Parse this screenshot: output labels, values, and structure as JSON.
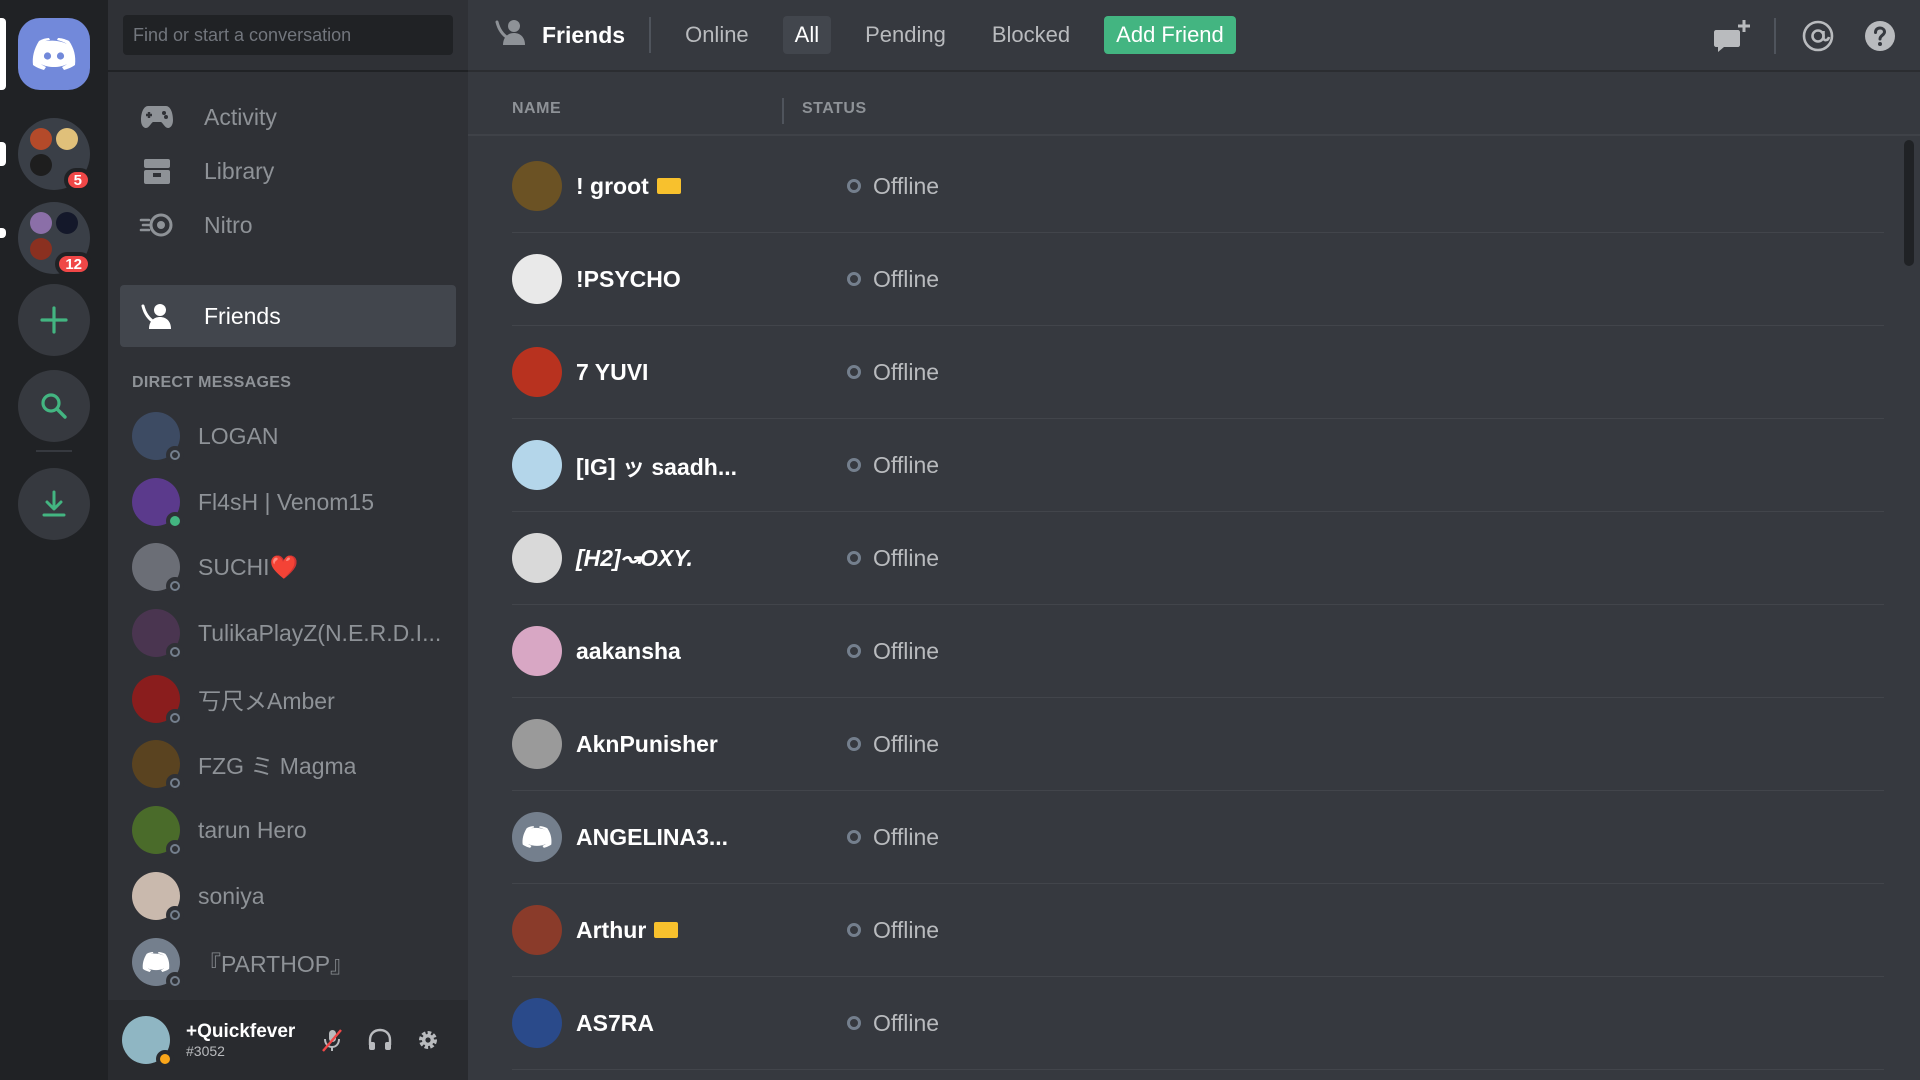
{
  "sidebar": {
    "search_placeholder": "Find or start a conversation",
    "nav": [
      {
        "label": "Activity",
        "icon": "controller-icon"
      },
      {
        "label": "Library",
        "icon": "library-icon"
      },
      {
        "label": "Nitro",
        "icon": "nitro-icon"
      },
      {
        "label": "Friends",
        "icon": "friends-icon"
      }
    ],
    "dm_header": "DIRECT MESSAGES",
    "dms": [
      {
        "name": "LOGAN",
        "status": "offline",
        "color": "#3d4b63"
      },
      {
        "name": "Fl4sH | Venom15",
        "status": "online",
        "color": "#5b3a8c"
      },
      {
        "name": "SUCHI❤️",
        "status": "offline",
        "color": "#6b6e76"
      },
      {
        "name": "TulikaPlayZ(N.E.R.D.I...",
        "status": "offline",
        "color": "#4a3550"
      },
      {
        "name": "丂尺メAmber",
        "status": "offline",
        "color": "#8a1d1d"
      },
      {
        "name": "FZG ミ Magma",
        "status": "offline",
        "color": "#5a4320"
      },
      {
        "name": "tarun Hero",
        "status": "offline",
        "color": "#4a6b2a"
      },
      {
        "name": "soniya",
        "status": "offline",
        "color": "#c9b9ad"
      },
      {
        "name": "『PARTHOP』",
        "status": "offline",
        "color": "#747f8d"
      }
    ]
  },
  "servers": {
    "badge1": "5",
    "badge2": "12"
  },
  "user": {
    "name": "+Quickfever",
    "tag": "#3052"
  },
  "topbar": {
    "title": "Friends",
    "tabs": [
      "Online",
      "All",
      "Pending",
      "Blocked"
    ],
    "add_friend": "Add Friend"
  },
  "table": {
    "col_name": "NAME",
    "col_status": "STATUS",
    "rows": [
      {
        "name": "! groot",
        "status": "Offline",
        "crown": true,
        "color": "#6b5224"
      },
      {
        "name": "!PSYCHO",
        "status": "Offline",
        "crown": false,
        "color": "#e9e9e9"
      },
      {
        "name": "7 YUVI",
        "status": "Offline",
        "crown": false,
        "color": "#b8321f"
      },
      {
        "name": "[IG] ッ saadh...",
        "status": "Offline",
        "crown": false,
        "color": "#b4d6ea"
      },
      {
        "name": "[H2]↝OXY.",
        "status": "Offline",
        "crown": false,
        "color": "#d9d9d9"
      },
      {
        "name": "aakansha",
        "status": "Offline",
        "crown": false,
        "color": "#d8a7c4"
      },
      {
        "name": "AknPunisher",
        "status": "Offline",
        "crown": false,
        "color": "#9a9a9a"
      },
      {
        "name": "ANGELINA3...",
        "status": "Offline",
        "crown": false,
        "color": "#747f8d"
      },
      {
        "name": "Arthur",
        "status": "Offline",
        "crown": true,
        "color": "#8a3b2a"
      },
      {
        "name": "AS7RA",
        "status": "Offline",
        "crown": false,
        "color": "#2a4a8a"
      }
    ]
  },
  "colors": {
    "accent": "#7289da",
    "add_friend": "#43b581",
    "badge": "#f04747",
    "idle": "#faa61a"
  }
}
